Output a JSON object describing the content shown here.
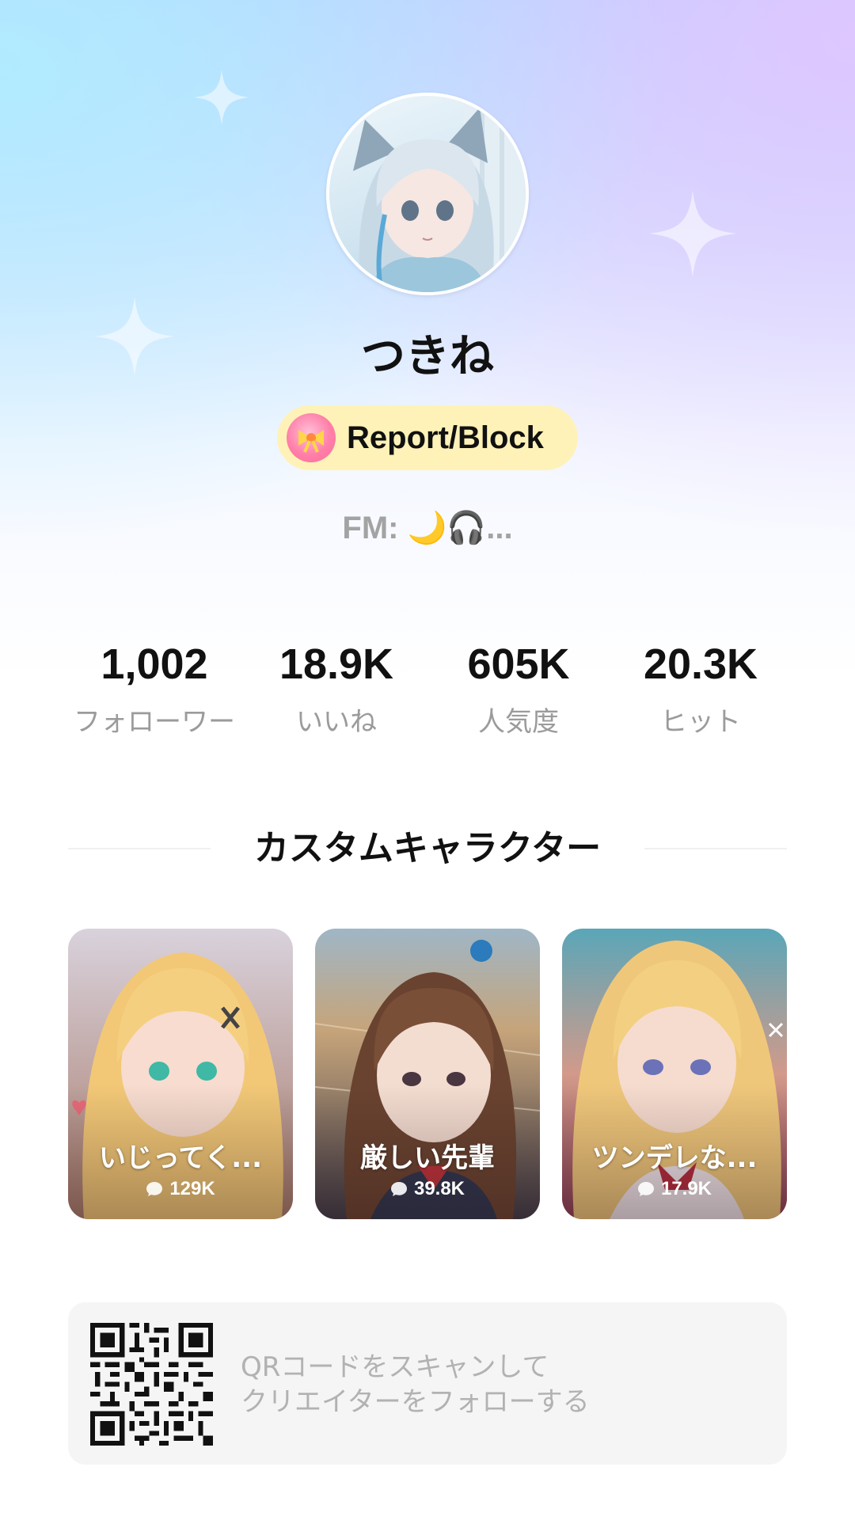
{
  "profile": {
    "name": "つきね",
    "report_label": "Report/Block",
    "fm_status": "FM: 🌙🎧..."
  },
  "stats": [
    {
      "value": "1,002",
      "label": "フォローワー"
    },
    {
      "value": "18.9K",
      "label": "いいね"
    },
    {
      "value": "605K",
      "label": "人気度"
    },
    {
      "value": "20.3K",
      "label": "ヒット"
    }
  ],
  "section": {
    "title": "カスタムキャラクター"
  },
  "characters": [
    {
      "name": "いじってく...",
      "chats": "129K"
    },
    {
      "name": "厳しい先輩",
      "chats": "39.8K"
    },
    {
      "name": "ツンデレな...",
      "chats": "17.9K"
    }
  ],
  "qr": {
    "line1": "QRコードをスキャンして",
    "line2": "クリエイターをフォローする"
  },
  "colors": {
    "report_bg": "#fff2b8",
    "text_primary": "#111111",
    "text_muted": "#9b9b9b",
    "panel_bg": "#f5f5f5"
  }
}
